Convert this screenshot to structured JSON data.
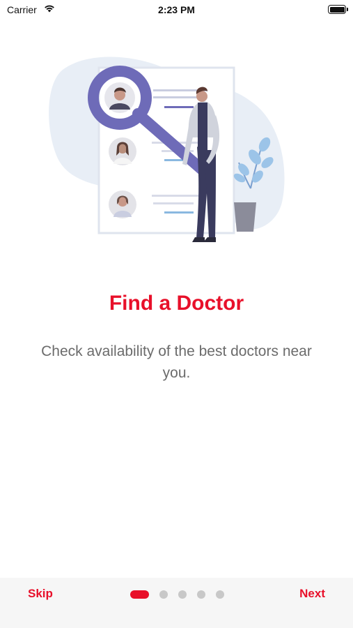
{
  "status_bar": {
    "carrier": "Carrier",
    "time": "2:23 PM",
    "wifi_icon": "wifi-icon",
    "battery_icon": "battery-icon"
  },
  "illustration": {
    "icon": "doctor-search-illustration"
  },
  "onboarding": {
    "title": "Find a Doctor",
    "subtitle": "Check availability of the best doctors near you."
  },
  "footer": {
    "skip_label": "Skip",
    "next_label": "Next",
    "page_count": 5,
    "current_page": 1
  },
  "colors": {
    "accent": "#e8102a",
    "subtitle": "#6b6b6b",
    "footer_bg": "#f6f6f6",
    "dot_inactive": "#c8c8c8",
    "illustration_purple": "#6e6bb8",
    "illustration_blob": "#e8eef6"
  }
}
